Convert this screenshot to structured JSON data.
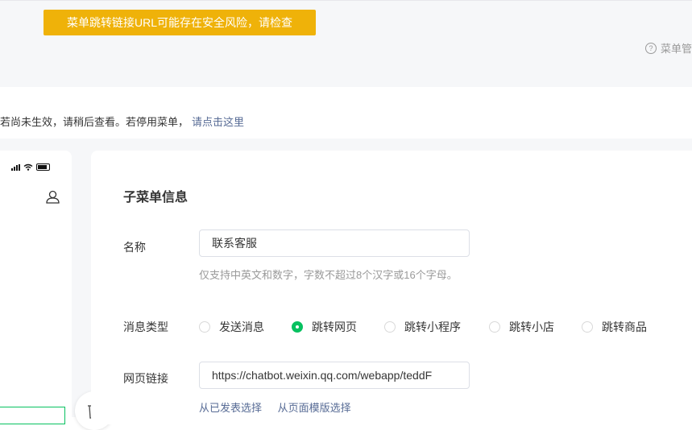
{
  "toast": {
    "text": "菜单跳转链接URL可能存在安全风险，请检查"
  },
  "help": {
    "icon": "question-circle-icon",
    "label": "菜单管"
  },
  "notice": {
    "text": "若尚未生效，请稍后查看。若停用菜单，",
    "link": "请点击这里"
  },
  "panel": {
    "title": "子菜单信息",
    "name_label": "名称",
    "name_value": "联系客服",
    "name_hint": "仅支持中英文和数字，字数不超过8个汉字或16个字母。",
    "type_label": "消息类型",
    "type_options": [
      {
        "label": "发送消息",
        "checked": false
      },
      {
        "label": "跳转网页",
        "checked": true
      },
      {
        "label": "跳转小程序",
        "checked": false
      },
      {
        "label": "跳转小店",
        "checked": false
      },
      {
        "label": "跳转商品",
        "checked": false
      }
    ],
    "url_label": "网页链接",
    "url_value": "https://chatbot.weixin.qq.com/webapp/teddF",
    "select_published": "从已发表选择",
    "select_template": "从页面模版选择"
  },
  "colors": {
    "accent": "#07c160",
    "warning": "#efb209",
    "link": "#576b95"
  }
}
